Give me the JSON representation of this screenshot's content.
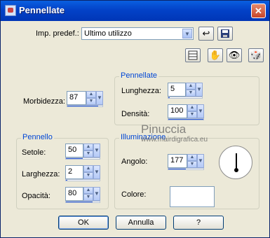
{
  "window": {
    "title": "Pennellate",
    "close_glyph": "✕"
  },
  "preset": {
    "label": "Imp. predef.:",
    "value": "Ultimo utilizzo"
  },
  "brush_strokes": {
    "title": "Pennellate",
    "length": {
      "label": "Lunghezza:",
      "value": "5"
    },
    "density": {
      "label": "Densità:",
      "value": "100"
    }
  },
  "softness": {
    "label": "Morbidezza:",
    "value": "87"
  },
  "brush": {
    "title": "Pennello",
    "bristles": {
      "label": "Setole:",
      "value": "50"
    },
    "width": {
      "label": "Larghezza:",
      "value": "2"
    },
    "opacity": {
      "label": "Opacità:",
      "value": "80"
    }
  },
  "lighting": {
    "title": "Illuminazione",
    "angle": {
      "label": "Angolo:",
      "value": "177"
    },
    "color": {
      "label": "Colore:",
      "value": "#ffffff"
    }
  },
  "buttons": {
    "ok": "OK",
    "cancel": "Annulla",
    "help": "?"
  },
  "watermark": {
    "line1": "Pinuccia",
    "line2": "www.mairdigrafica.eu"
  },
  "icons": [
    "window-icon",
    "reset-arrow-icon",
    "save-icon",
    "preview-icon",
    "hand-eye-icon",
    "eye-icon",
    "random-dice-icon"
  ],
  "colors": {
    "title_bar": "#0342c8",
    "group_title": "#0046d5",
    "dialog_bg": "#ece9d8"
  }
}
